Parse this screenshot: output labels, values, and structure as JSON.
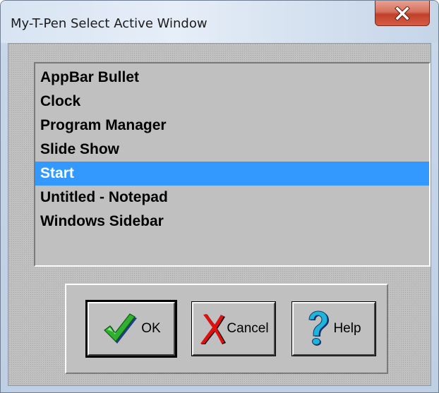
{
  "window": {
    "title": "My-T-Pen Select Active Window",
    "close_icon": "close-x-icon"
  },
  "list": {
    "items": [
      "AppBar Bullet",
      "Clock",
      "Program Manager",
      "Slide Show",
      "Start",
      "Untitled - Notepad",
      "Windows Sidebar"
    ],
    "selected": "Start",
    "selected_color": "#3399ff"
  },
  "buttons": {
    "ok": {
      "label": "OK",
      "icon": "checkmark-icon"
    },
    "cancel": {
      "label": "Cancel",
      "icon": "red-x-icon"
    },
    "help": {
      "label": "Help",
      "icon": "question-mark-icon"
    }
  }
}
